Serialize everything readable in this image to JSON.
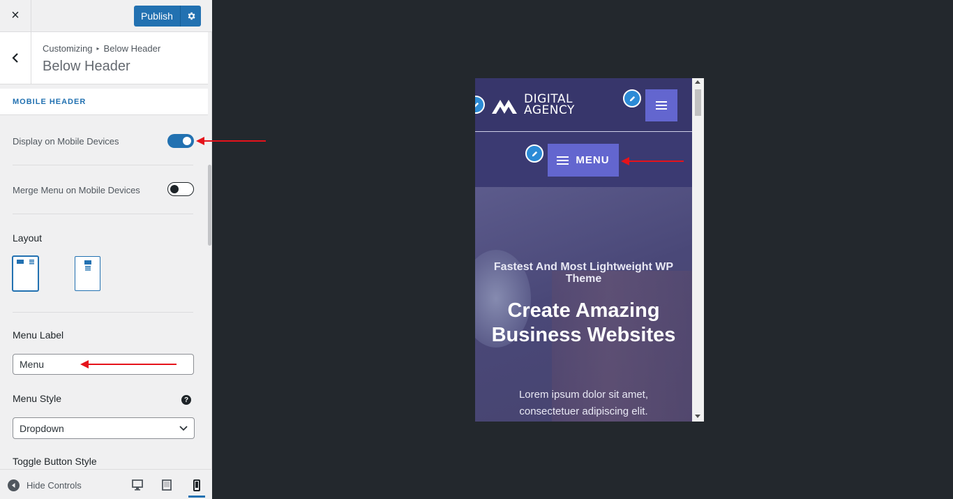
{
  "topbar": {
    "close_icon": "×",
    "publish_label": "Publish",
    "settings_icon": "gear-icon"
  },
  "header": {
    "breadcrumb_root": "Customizing",
    "breadcrumb_current": "Below Header",
    "title": "Below Header"
  },
  "section": {
    "title": "MOBILE HEADER"
  },
  "controls": {
    "display_mobile": {
      "label": "Display on Mobile Devices",
      "enabled": true
    },
    "merge_menu": {
      "label": "Merge Menu on Mobile Devices",
      "enabled": false
    },
    "layout": {
      "label": "Layout",
      "options": [
        "layout-1",
        "layout-2"
      ],
      "selected": "layout-1"
    },
    "menu_label": {
      "label": "Menu Label",
      "value": "Menu"
    },
    "menu_style": {
      "label": "Menu Style",
      "help": "?",
      "value": "Dropdown"
    },
    "toggle_button_style": {
      "label": "Toggle Button Style"
    }
  },
  "footer": {
    "hide_controls": "Hide Controls",
    "devices": [
      "desktop",
      "tablet",
      "mobile"
    ],
    "active_device": "mobile"
  },
  "preview": {
    "logo_line1": "DIGITAL",
    "logo_line2": "AGENCY",
    "menu_button": "MENU",
    "hero_subtitle": "Fastest And Most Lightweight WP Theme",
    "hero_title": "Create Amazing Business Websites",
    "hero_text": "Lorem ipsum dolor sit amet, consectetuer adipiscing elit."
  },
  "colors": {
    "accent": "#2271b1",
    "preview_header": "#37366b",
    "menu_button": "#6366cf",
    "annotation_arrow": "#e5131b"
  }
}
